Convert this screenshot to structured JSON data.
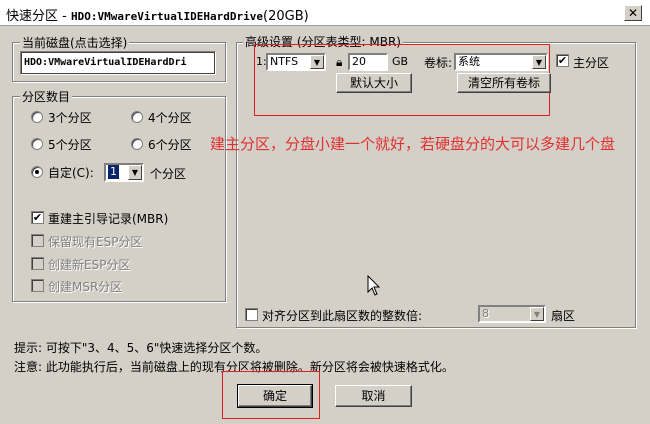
{
  "window": {
    "title_prefix": "快速分区 - ",
    "title_disk": "HDO:VMwareVirtualIDEHardDrive",
    "title_size": "(20GB)",
    "close_label": "✕"
  },
  "disk_group": {
    "title": "当前磁盘(点击选择)",
    "disk_name": "HDO:VMwareVirtualIDEHardDri"
  },
  "count_group": {
    "title": "分区数目",
    "options": [
      {
        "label": "3个分区",
        "checked": false
      },
      {
        "label": "4个分区",
        "checked": false
      },
      {
        "label": "5个分区",
        "checked": false
      },
      {
        "label": "6个分区",
        "checked": false
      }
    ],
    "custom_label": "自定(C):",
    "custom_value": "1",
    "custom_suffix": "个分区",
    "checkboxes": [
      {
        "label": "重建主引导记录(MBR)",
        "checked": true,
        "enabled": true
      },
      {
        "label": "保留现有ESP分区",
        "checked": false,
        "enabled": false
      },
      {
        "label": "创建新ESP分区",
        "checked": false,
        "enabled": false
      },
      {
        "label": "创建MSR分区",
        "checked": false,
        "enabled": false
      }
    ]
  },
  "advanced": {
    "title": "高级设置 (分区表类型: MBR)",
    "row_label": "1:",
    "fs_value": "NTFS",
    "size_value": "20",
    "size_unit": "GB",
    "volume_label_text": "卷标:",
    "volume_value": "系统",
    "primary_label": "主分区",
    "primary_checked": true,
    "default_size_btn": "默认大小",
    "clear_labels_btn": "清空所有卷标",
    "align_label": "对齐分区到此扇区数的整数倍:",
    "align_value": "8",
    "align_unit": "扇区"
  },
  "annotation": "建主分区，分盘小建一个就好，若硬盘分的大可以多建几个盘",
  "hints": {
    "line1": "提示: 可按下\"3、4、5、6\"快速选择分区个数。",
    "line2": "注意: 此功能执行后，当前磁盘上的现有分区将被删除。新分区将会被快速格式化。"
  },
  "buttons": {
    "ok": "确定",
    "cancel": "取消"
  },
  "colors": {
    "window_bg": "#d4d0c8",
    "annotation_red": "#e03030"
  }
}
